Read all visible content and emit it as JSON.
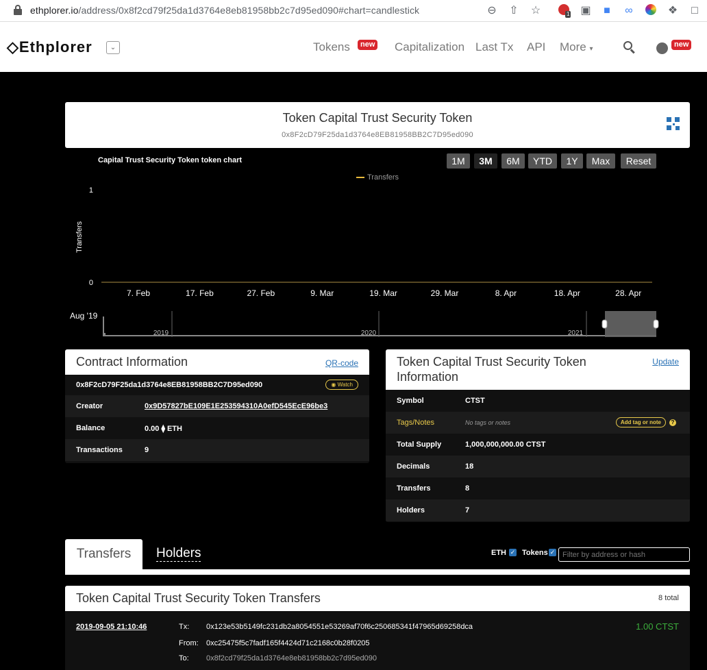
{
  "browser": {
    "url_host": "ethplorer.io",
    "url_path": "/address/0x8f2cd79f25da1d3764e8eb81958bb2c7d95ed090#chart=candlestick",
    "ext_badge": "1"
  },
  "nav": {
    "logo": "Ethplorer",
    "items": [
      "Tokens",
      "Capitalization",
      "Last Tx",
      "API",
      "More"
    ],
    "new_badge": "new"
  },
  "token": {
    "title": "Token Capital Trust Security Token",
    "address": "0x8F2cD79F25da1d3764e8EB81958BB2C7D95ed090"
  },
  "chart_data": {
    "type": "line",
    "title": "Capital Trust Security Token token chart",
    "range_buttons": [
      "1M",
      "3M",
      "6M",
      "YTD",
      "1Y",
      "Max",
      "Reset"
    ],
    "active_range": "3M",
    "series": [
      {
        "name": "Transfers",
        "color": "#e8b93b",
        "values": [
          0,
          0,
          0,
          0,
          0,
          0,
          0,
          0,
          0
        ]
      }
    ],
    "x_ticks": [
      "7. Feb",
      "17. Feb",
      "27. Feb",
      "9. Mar",
      "19. Mar",
      "29. Mar",
      "8. Apr",
      "18. Apr",
      "28. Apr"
    ],
    "ylabel": "Transfers",
    "y_ticks": [
      "0",
      "1"
    ],
    "ylim": [
      0,
      1
    ],
    "navigator_labels": [
      "Aug '19",
      "2019",
      "2020",
      "2021"
    ]
  },
  "contract": {
    "heading": "Contract Information",
    "qr_link": "QR-code",
    "address": "0x8F2cD79F25da1d3764e8EB81958BB2C7D95ed090",
    "watch_label": "Watch",
    "rows": [
      {
        "label": "Creator",
        "value": "0x9D57827bE109E1E253594310A0efD545EcE96be3"
      },
      {
        "label": "Balance",
        "value": "0.00 ⧫ ETH"
      },
      {
        "label": "Transactions",
        "value": "9"
      }
    ]
  },
  "token_info": {
    "heading": "Token Capital Trust Security Token Information",
    "update_link": "Update",
    "rows": [
      {
        "label": "Symbol",
        "value": "CTST"
      },
      {
        "label": "Tags/Notes",
        "value": "No tags or notes"
      },
      {
        "label": "Total Supply",
        "value": "1,000,000,000.00 CTST"
      },
      {
        "label": "Decimals",
        "value": "18"
      },
      {
        "label": "Transfers",
        "value": "8"
      },
      {
        "label": "Holders",
        "value": "7"
      }
    ],
    "add_tag_label": "Add tag or note",
    "help": "?"
  },
  "tabs": {
    "transfers": "Transfers",
    "holders": "Holders",
    "eth_label": "ETH",
    "tokens_label": "Tokens",
    "filter_placeholder": "Filter by address or hash"
  },
  "transfers": {
    "heading": "Token Capital Trust Security Token Transfers",
    "total": "8 total",
    "rows": [
      {
        "date": "2019-09-05 21:10:46",
        "tx_label": "Tx:",
        "tx": "0x123e53b5149fc231db2a8054551e53269af70f6c250685341f47965d69258dca",
        "from_label": "From:",
        "from": "0xc25475f5c7fadf165f4424d71c2168c0b28f0205",
        "to_label": "To:",
        "to": "0x8f2cd79f25da1d3764e8eb81958bb2c7d95ed090",
        "amount": "1.00 CTST"
      }
    ]
  }
}
